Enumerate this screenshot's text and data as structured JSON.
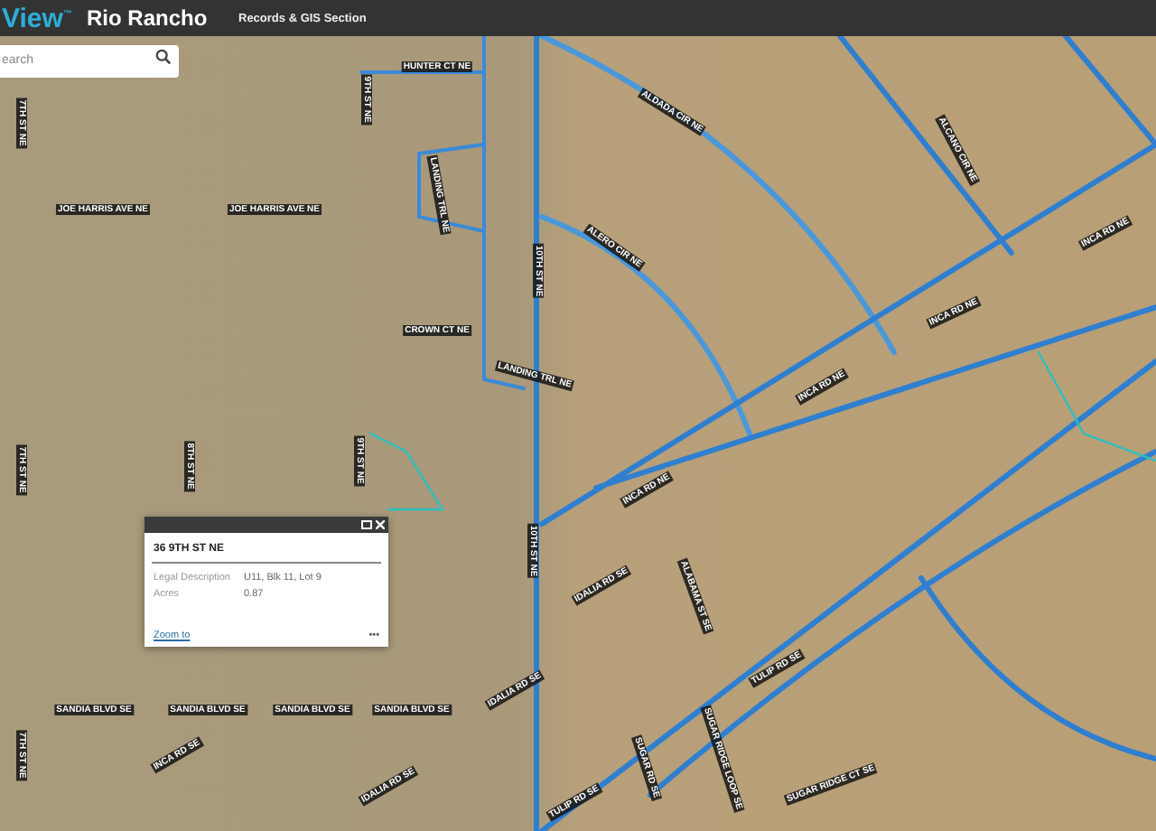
{
  "header": {
    "logo": "View",
    "logo_mark": "™",
    "city": "Rio Rancho",
    "section": "Records & GIS Section"
  },
  "search": {
    "placeholder": "earch"
  },
  "map_labels": [
    "HUNTER CT NE",
    "9TH ST NE",
    "7TH ST NE",
    "LANDING TRL NE",
    "JOE HARRIS AVE NE",
    "JOE HARRIS AVE NE",
    "10TH ST NE",
    "ALDADA CIR NE",
    "ALCANO CIR NE",
    "ALERO CIR NE",
    "INCA RD NE",
    "CROWN CT NE",
    "INCA RD NE",
    "LANDING TRL NE",
    "INCA RD NE",
    "7TH ST NE",
    "8TH ST NE",
    "9TH ST NE",
    "INCA RD NE",
    "10TH ST NE",
    "IDALIA RD SE",
    "ALABAMA ST SE",
    "SANDIA BLVD SE",
    "SANDIA BLVD SE",
    "SANDIA BLVD SE",
    "SANDIA BLVD SE",
    "IDALIA RD SE",
    "TULIP RD SE",
    "SUGAR RIDGE LOOP SE",
    "SUGAR RD SE",
    "INCA RD SE",
    "IDALIA RD SE",
    "TULIP RD SE",
    "SUGAR RIDGE CT SE",
    "7TH ST NE"
  ],
  "popup": {
    "title": "36 9TH ST NE",
    "fields": [
      {
        "label": "Legal Description",
        "value": "U11, Blk 11, Lot 9"
      },
      {
        "label": "Acres",
        "value": "0.87"
      }
    ],
    "link": "Zoom to",
    "more": "•••"
  }
}
